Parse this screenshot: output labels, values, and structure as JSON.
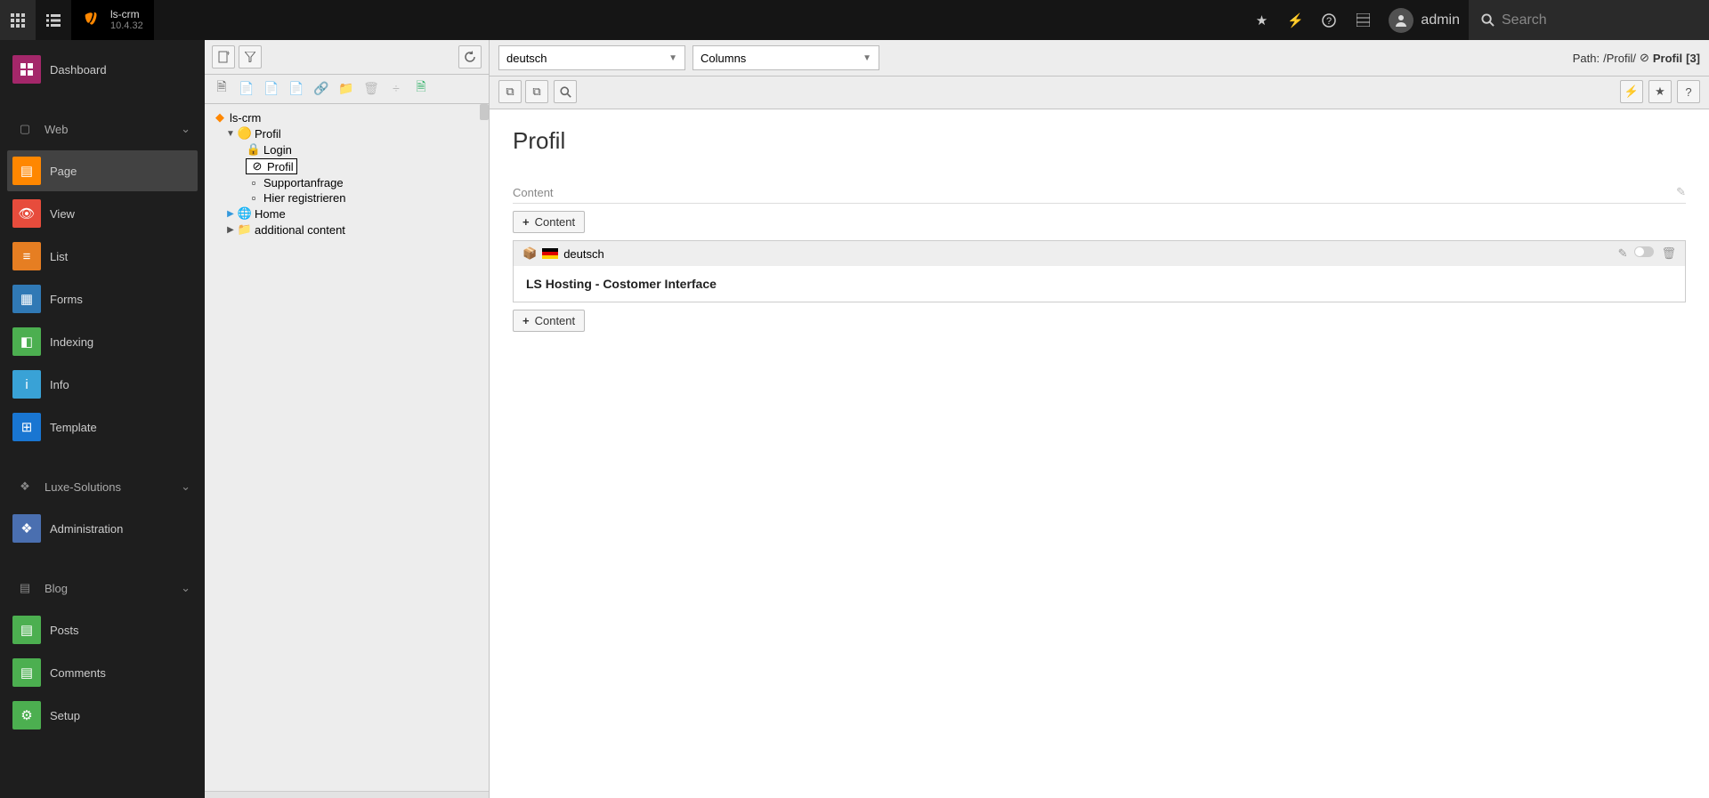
{
  "topbar": {
    "site_name": "ls-crm",
    "version": "10.4.32",
    "user": "admin",
    "search_placeholder": "Search"
  },
  "modules": {
    "dashboard": "Dashboard",
    "groups": [
      {
        "label": "Web",
        "items": [
          {
            "label": "Page",
            "color": "#ff8700",
            "active": true
          },
          {
            "label": "View",
            "color": "#e74c3c"
          },
          {
            "label": "List",
            "color": "#e67e22"
          },
          {
            "label": "Forms",
            "color": "#3079b5"
          },
          {
            "label": "Indexing",
            "color": "#4caf50"
          },
          {
            "label": "Info",
            "color": "#39a2d6"
          },
          {
            "label": "Template",
            "color": "#1976d2"
          }
        ]
      },
      {
        "label": "Luxe-Solutions",
        "items": [
          {
            "label": "Administration",
            "color": "#4a6fb0"
          }
        ]
      },
      {
        "label": "Blog",
        "items": [
          {
            "label": "Posts",
            "color": "#4caf50"
          },
          {
            "label": "Comments",
            "color": "#4caf50"
          },
          {
            "label": "Setup",
            "color": "#4caf50"
          }
        ]
      }
    ]
  },
  "tree": {
    "root": "ls-crm",
    "nodes": [
      {
        "label": "Profil",
        "level": 1,
        "toggle": "▼"
      },
      {
        "label": "Login",
        "level": 2
      },
      {
        "label": "Profil",
        "level": 2,
        "selected": true
      },
      {
        "label": "Supportanfrage",
        "level": 2
      },
      {
        "label": "Hier registrieren",
        "level": 2
      },
      {
        "label": "Home",
        "level": 1,
        "toggle": "▶"
      },
      {
        "label": "additional content",
        "level": 1,
        "toggle": "▶"
      }
    ]
  },
  "content": {
    "language_select": "deutsch",
    "layout_select": "Columns",
    "path_label": "Path:",
    "path_value": "/Profil/",
    "path_page": "Profil",
    "path_id": "[3]",
    "page_title": "Profil",
    "column_label": "Content",
    "add_content_btn": "Content",
    "ce_lang": "deutsch",
    "ce_title": "LS Hosting - Costomer Interface"
  }
}
